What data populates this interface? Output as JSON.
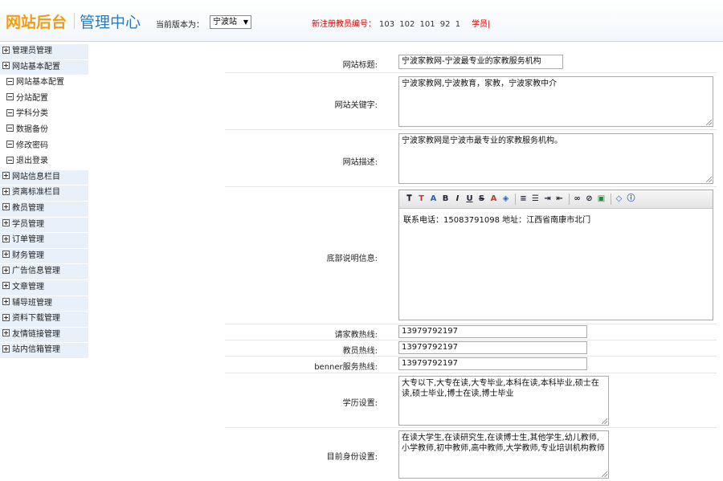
{
  "header": {
    "logo_main": "网站后台",
    "logo_sub": "管理中心",
    "version_label": "当前版本为：",
    "version_value": "宁波站",
    "notice_label": "新注册教员编号：",
    "notice_numbers": "103 102 101 92 1",
    "notice_student": "学员|"
  },
  "sidebar": {
    "items": [
      {
        "label": "管理员管理",
        "type": "group"
      },
      {
        "label": "网站基本配置",
        "type": "group-open"
      },
      {
        "label": "网站基本配置",
        "type": "sub"
      },
      {
        "label": "分站配置",
        "type": "sub"
      },
      {
        "label": "学科分类",
        "type": "sub"
      },
      {
        "label": "数据备份",
        "type": "sub"
      },
      {
        "label": "修改密码",
        "type": "sub"
      },
      {
        "label": "退出登录",
        "type": "sub"
      },
      {
        "label": "网站信息栏目",
        "type": "group"
      },
      {
        "label": "资离标准栏目",
        "type": "group"
      },
      {
        "label": "教员管理",
        "type": "group"
      },
      {
        "label": "学员管理",
        "type": "group"
      },
      {
        "label": "订单管理",
        "type": "group"
      },
      {
        "label": "财务管理",
        "type": "group"
      },
      {
        "label": "广告信息管理",
        "type": "group"
      },
      {
        "label": "文章管理",
        "type": "group"
      },
      {
        "label": "辅导班管理",
        "type": "group"
      },
      {
        "label": "资料下载管理",
        "type": "group"
      },
      {
        "label": "友情链接管理",
        "type": "group"
      },
      {
        "label": "站内信箱管理",
        "type": "group"
      }
    ]
  },
  "form": {
    "site_title": {
      "label": "网站标题:",
      "value": "宁波家教网-宁波最专业的家教服务机构"
    },
    "keywords": {
      "label": "网站关键字:",
      "value": "宁波家教网,宁波教育，家教，宁波家教中介"
    },
    "description": {
      "label": "网站描述:",
      "value": "宁波家教网是宁波市最专业的家教服务机构。"
    },
    "footer": {
      "label": "底部说明信息:",
      "value": "联系电话：15083791098     地址：江西省南康市北门"
    },
    "hotline_parent": {
      "label": "请家教热线:",
      "value": "13979792197"
    },
    "hotline_teacher": {
      "label": "教员热线:",
      "value": "13979792197"
    },
    "hotline_banner": {
      "label": "benner服务热线:",
      "value": "13979792197"
    },
    "education": {
      "label": "学历设置:",
      "value": "大专以下,大专在读,大专毕业,本科在读,本科毕业,硕士在读,硕士毕业,博士在读,博士毕业"
    },
    "identity": {
      "label": "目前身份设置:",
      "value": "在读大学生,在读研究生,在读博士生,其他学生,幼儿教师,小学教师,初中教师,高中教师,大学教师,专业培训机构教师"
    }
  }
}
